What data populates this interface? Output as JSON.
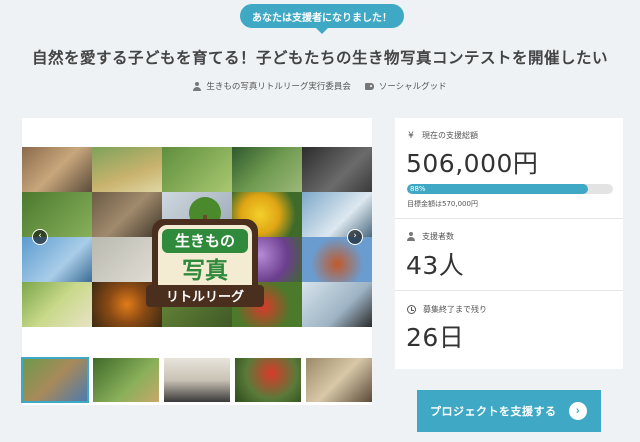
{
  "banner": {
    "supporter_text": "あなたは支援者になりました！"
  },
  "project": {
    "title": "自然を愛する子どもを育てる！子どもたちの生き物写真コンテストを開催したい",
    "owner": "生きもの写真リトルリーグ実行委員会",
    "category": "ソーシャルグッド"
  },
  "gallery": {
    "prev_label": "‹",
    "next_label": "›",
    "logo_lines": [
      "生きもの",
      "写真",
      "リトルリーグ"
    ],
    "thumbnail_count": 5,
    "active_thumbnail": 0
  },
  "stats": {
    "total_label": "現在の支援総額",
    "total_amount": "506,000円",
    "progress_percent": 88,
    "progress_text": "88%",
    "goal_text": "目標金額は570,000円",
    "supporters_label": "支援者数",
    "supporters_count": "43人",
    "remaining_label": "募集終了まで残り",
    "remaining_days": "26日"
  },
  "actions": {
    "support_label": "プロジェクトを支援する",
    "support_arrow": "›"
  },
  "icons": {
    "currency": "yen-icon",
    "owner": "user-icon",
    "category": "tag-icon",
    "supporters": "user-icon",
    "remaining": "clock-icon"
  },
  "colors": {
    "accent": "#3fa8c4",
    "background": "#eef2f5",
    "progress_track": "#e3e3e3"
  }
}
